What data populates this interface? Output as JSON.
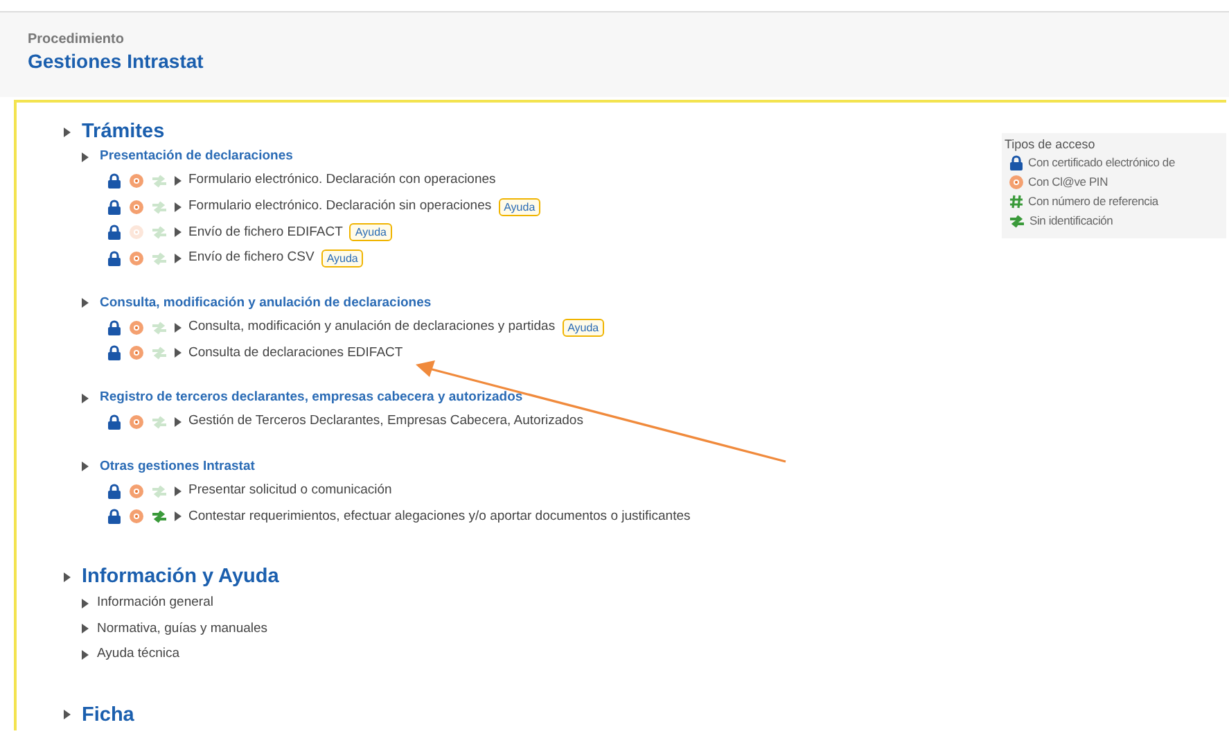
{
  "header": {
    "label": "Procedimiento",
    "title": "Gestiones Intrastat"
  },
  "sections": [
    {
      "title": "Trámites",
      "groups": [
        {
          "title": "Presentación de declaraciones",
          "items": [
            {
              "label": "Formulario electrónico. Declaración con operaciones",
              "certificate": true,
              "clave": true,
              "no_id": false
            },
            {
              "label": "Formulario electrónico. Declaración sin operaciones",
              "certificate": true,
              "clave": true,
              "no_id": false,
              "help": "Ayuda"
            },
            {
              "label": "Envío de fichero EDIFACT",
              "certificate": true,
              "clave": false,
              "no_id": false,
              "help": "Ayuda"
            },
            {
              "label": "Envío de fichero CSV",
              "certificate": true,
              "clave": true,
              "no_id": false,
              "help": "Ayuda"
            }
          ]
        },
        {
          "title": "Consulta, modificación y anulación de declaraciones",
          "items": [
            {
              "label": "Consulta, modificación y anulación de declaraciones y partidas",
              "certificate": true,
              "clave": true,
              "no_id": false,
              "help": "Ayuda"
            },
            {
              "label": "Consulta de declaraciones EDIFACT",
              "certificate": true,
              "clave": true,
              "no_id": false
            }
          ]
        },
        {
          "title": "Registro de terceros declarantes, empresas cabecera y autorizados",
          "items": [
            {
              "label": "Gestión de Terceros Declarantes, Empresas Cabecera, Autorizados",
              "certificate": true,
              "clave": true,
              "no_id": false
            }
          ]
        },
        {
          "title": "Otras gestiones Intrastat",
          "items": [
            {
              "label": "Presentar solicitud o comunicación",
              "certificate": true,
              "clave": true,
              "no_id": false
            },
            {
              "label": "Contestar requerimientos, efectuar alegaciones y/o aportar documentos o justificantes",
              "certificate": true,
              "clave": true,
              "no_id": true
            }
          ]
        }
      ]
    },
    {
      "title": "Información y Ayuda",
      "links": [
        "Información general",
        "Normativa, guías y manuales",
        "Ayuda técnica"
      ]
    },
    {
      "title": "Ficha"
    }
  ],
  "legend": {
    "title": "Tipos de acceso",
    "items": [
      {
        "kind": "certificate",
        "label": "Con certificado electrónico de"
      },
      {
        "kind": "clave",
        "label": "Con Cl@ve PIN"
      },
      {
        "kind": "reference",
        "label": "Con número de referencia"
      },
      {
        "kind": "no_id",
        "label": "Sin identificación"
      }
    ]
  }
}
